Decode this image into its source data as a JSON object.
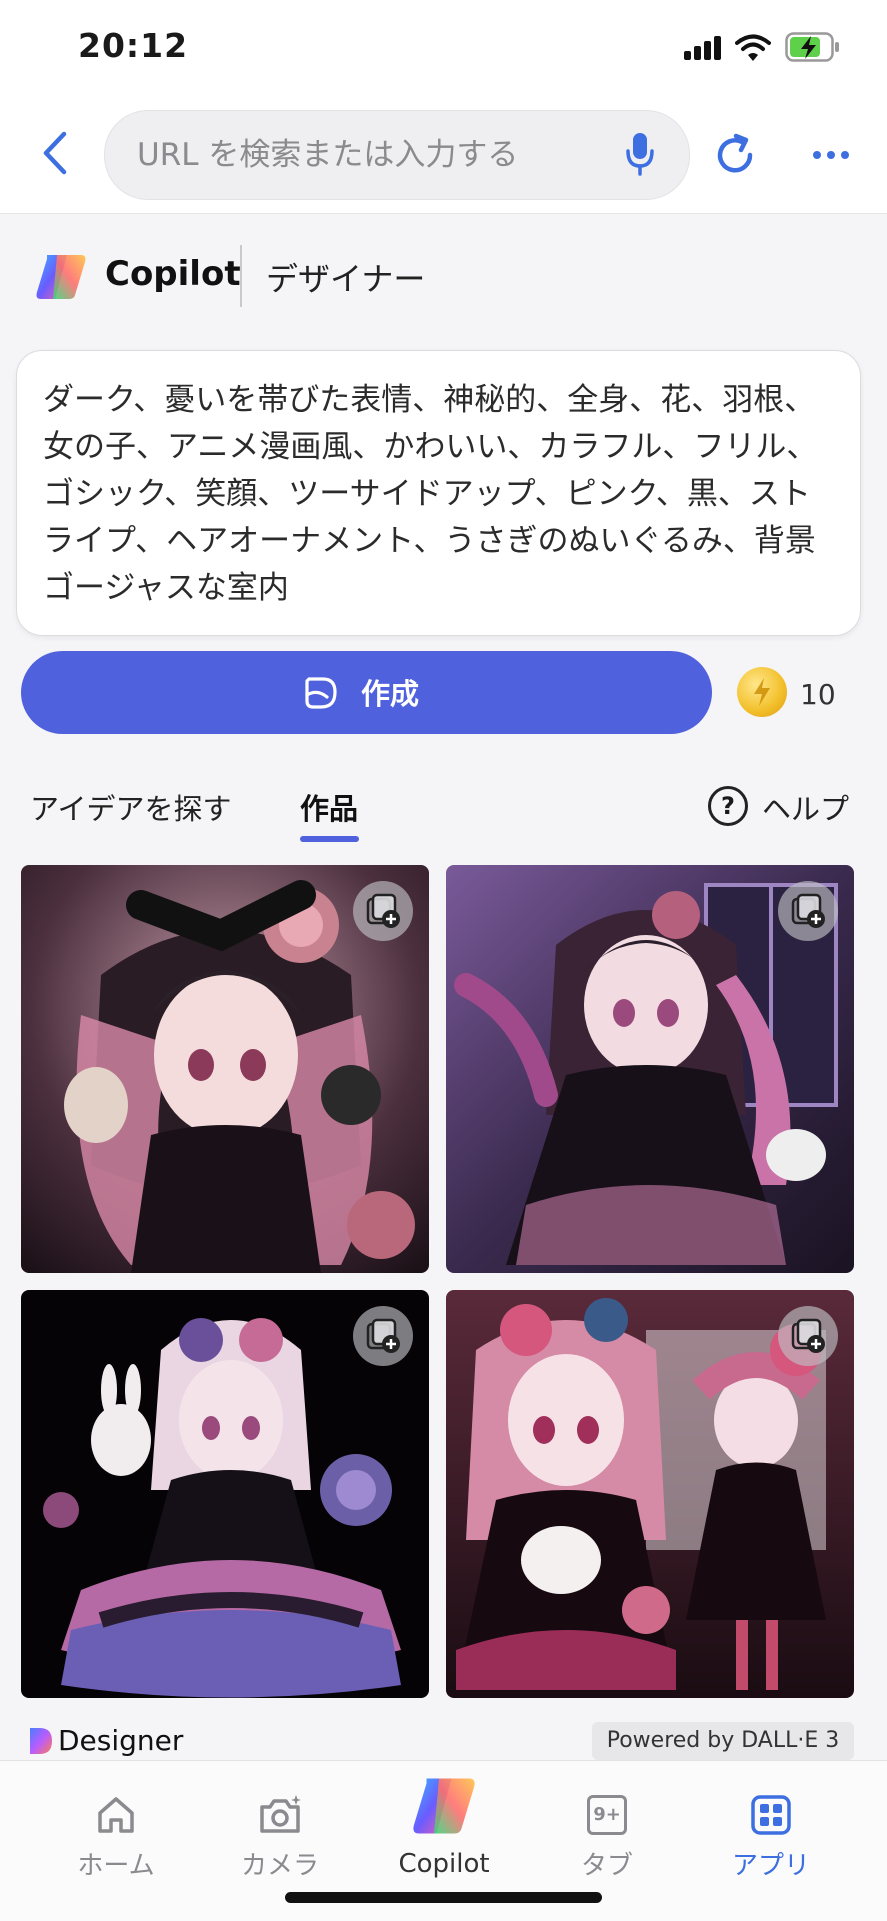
{
  "status_bar": {
    "time": "20:12"
  },
  "browser": {
    "url_placeholder": "URL を検索または入力する"
  },
  "header": {
    "app_name": "Copilot",
    "section": "デザイナー"
  },
  "prompt": {
    "text": "ダーク、憂いを帯びた表情、神秘的、全身、花、羽根、女の子、アニメ漫画風、かわいい、カラフル、フリル、ゴシック、笑顔、ツーサイドアップ、ピンク、黒、ストライプ、ヘアオーナメント、うさぎのぬいぐるみ、背景ゴージャスな室内"
  },
  "create": {
    "label": "作成",
    "boost_count": "10"
  },
  "tabs": {
    "explore": "アイデアを探す",
    "creations": "作品",
    "help": "ヘルプ"
  },
  "footer": {
    "brand": "Designer",
    "powered_by": "Powered by DALL·E 3"
  },
  "nav": {
    "home": "ホーム",
    "camera": "カメラ",
    "copilot": "Copilot",
    "tabs": "タブ",
    "tabs_badge": "9+",
    "apps": "アプリ"
  },
  "colors": {
    "accent": "#5061dd",
    "active_nav": "#3d6fe0",
    "inactive_nav": "#8a8a8f"
  }
}
